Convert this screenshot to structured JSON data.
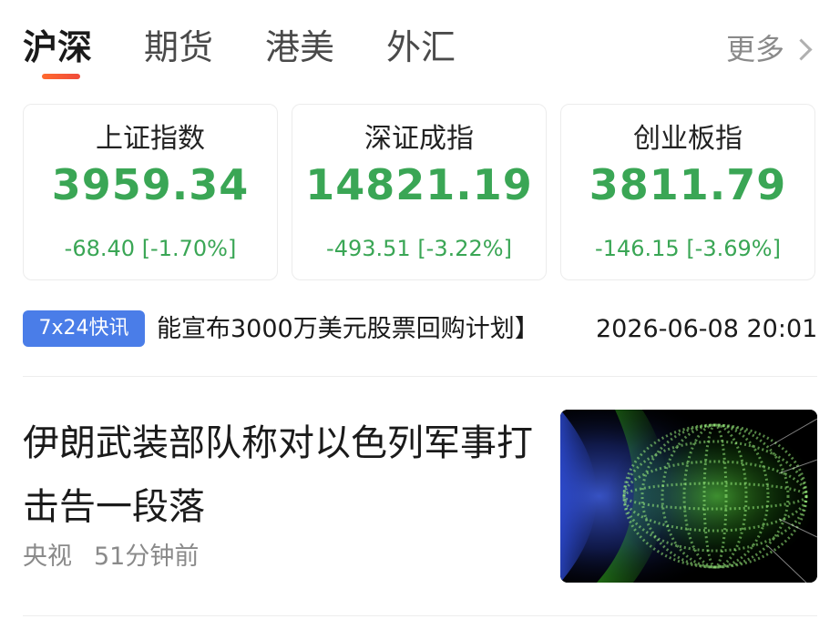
{
  "tabs": [
    {
      "label": "沪深",
      "active": true
    },
    {
      "label": "期货",
      "active": false
    },
    {
      "label": "港美",
      "active": false
    },
    {
      "label": "外汇",
      "active": false
    }
  ],
  "more_label": "更多",
  "indices": [
    {
      "name": "上证指数",
      "value": "3959.34",
      "change": "-68.40",
      "change_pct": "[-1.70%]"
    },
    {
      "name": "深证成指",
      "value": "14821.19",
      "change": "-493.51",
      "change_pct": "[-3.22%]"
    },
    {
      "name": "创业板指",
      "value": "3811.79",
      "change": "-146.15",
      "change_pct": "[-3.69%]"
    }
  ],
  "colors": {
    "down": "#3aa655",
    "accent_tab": "#f2553a",
    "badge": "#4a7de8"
  },
  "flash": {
    "badge": "7x24快讯",
    "text": "能宣布3000万美元股票回购计划】",
    "time": "2026-06-08 20:01"
  },
  "news": [
    {
      "title": "伊朗武装部队称对以色列军事打击告一段落",
      "source": "央视",
      "time": "51分钟前",
      "thumbnail_icon": "binary-sphere-image"
    }
  ]
}
